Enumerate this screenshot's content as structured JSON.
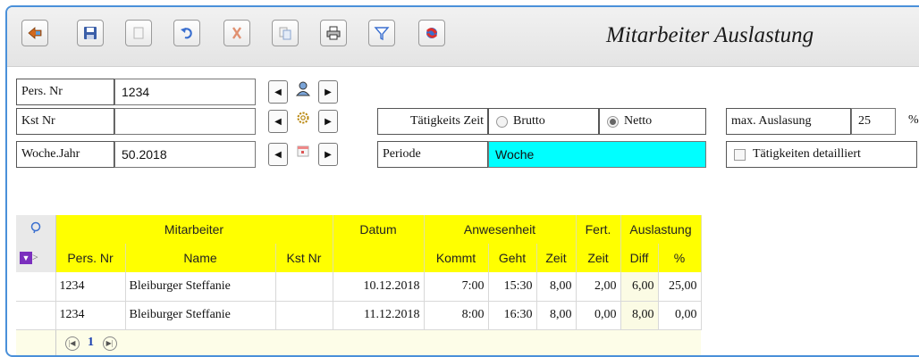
{
  "app": {
    "title": "Mitarbeiter Auslastung"
  },
  "toolbar": {
    "buttons": [
      {
        "icon": "back-arrow-icon"
      },
      {
        "icon": "save-disk-icon"
      },
      {
        "icon": "new-document-icon"
      },
      {
        "icon": "undo-icon"
      },
      {
        "icon": "delete-icon"
      },
      {
        "icon": "copy-icon"
      },
      {
        "icon": "print-icon"
      },
      {
        "icon": "filter-icon"
      },
      {
        "icon": "refresh-icon"
      }
    ]
  },
  "filters": {
    "pers_nr_label": "Pers. Nr",
    "pers_nr_value": "1234",
    "kst_nr_label": "Kst Nr",
    "kst_nr_value": "",
    "woche_jahr_label": "Woche.Jahr",
    "woche_jahr_value": "50.2018",
    "taetigkeits_zeit_label": "Tätigkeits Zeit",
    "brutto_label": "Brutto",
    "netto_label": "Netto",
    "periode_label": "Periode",
    "periode_value": "Woche",
    "max_auslastung_label": "max. Auslasung",
    "max_auslastung_value": "25",
    "percent_sign": "%",
    "taetigkeiten_detailliert_label": "Tätigkeiten detailliert"
  },
  "grid": {
    "group_headers": {
      "mitarbeiter": "Mitarbeiter",
      "datum": "Datum",
      "anwesenheit": "Anwesenheit",
      "fert": "Fert.",
      "auslastung": "Auslastung"
    },
    "columns": {
      "pers_nr": "Pers. Nr",
      "name": "Name",
      "kst_nr": "Kst Nr",
      "kommt": "Kommt",
      "geht": "Geht",
      "zeit": "Zeit",
      "fert_zeit": "Zeit",
      "diff": "Diff",
      "percent": "%"
    },
    "rows": [
      {
        "pers_nr": "1234",
        "name": "Bleiburger Steffanie",
        "kst_nr": "",
        "datum": "10.12.2018",
        "kommt": "7:00",
        "geht": "15:30",
        "zeit": "8,00",
        "fert_zeit": "2,00",
        "diff": "6,00",
        "percent": "25,00"
      },
      {
        "pers_nr": "1234",
        "name": "Bleiburger Steffanie",
        "kst_nr": "",
        "datum": "11.12.2018",
        "kommt": "8:00",
        "geht": "16:30",
        "zeit": "8,00",
        "fert_zeit": "0,00",
        "diff": "8,00",
        "percent": "0,00"
      }
    ],
    "pager": {
      "current_page": "1"
    }
  },
  "colors": {
    "header_bg": "#ffff00",
    "periode_bg": "#00ffff",
    "frame_border": "#4a90d9"
  }
}
